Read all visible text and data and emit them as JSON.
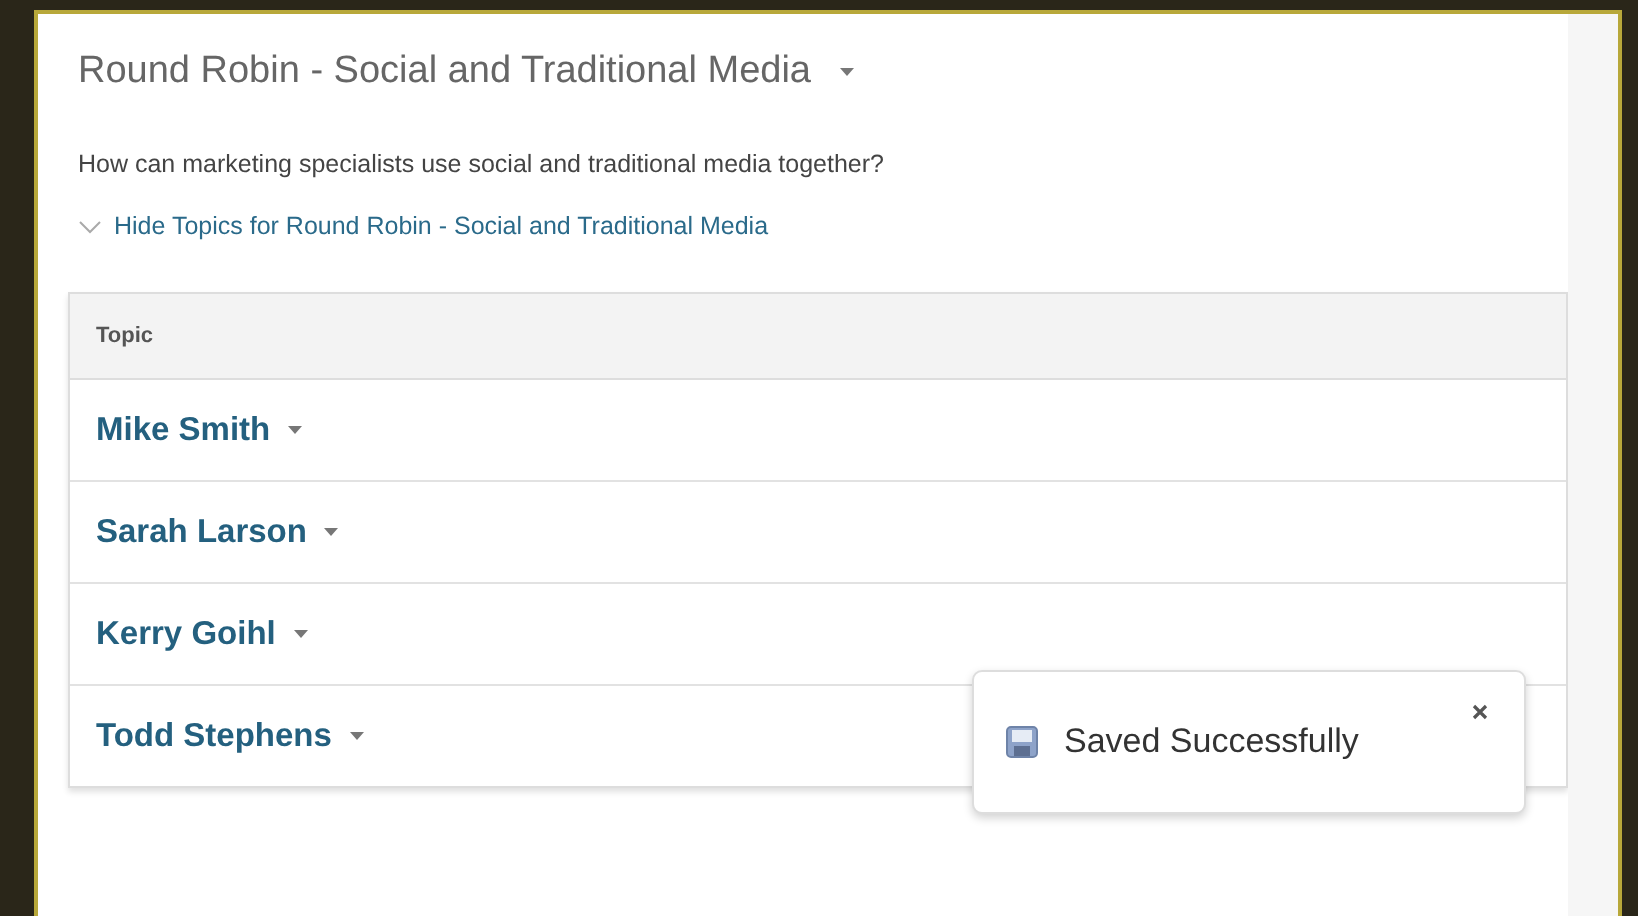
{
  "title": "Round Robin - Social and Traditional Media",
  "description": "How can marketing specialists use social and traditional media together?",
  "toggle_link": {
    "label": "Hide Topics for Round Robin - Social and Traditional Media",
    "expanded": true
  },
  "table": {
    "columns": [
      "Topic"
    ],
    "rows": [
      {
        "name": "Mike Smith"
      },
      {
        "name": "Sarah Larson"
      },
      {
        "name": "Kerry Goihl"
      },
      {
        "name": "Todd Stephens"
      }
    ]
  },
  "toast": {
    "message": "Saved Successfully"
  }
}
